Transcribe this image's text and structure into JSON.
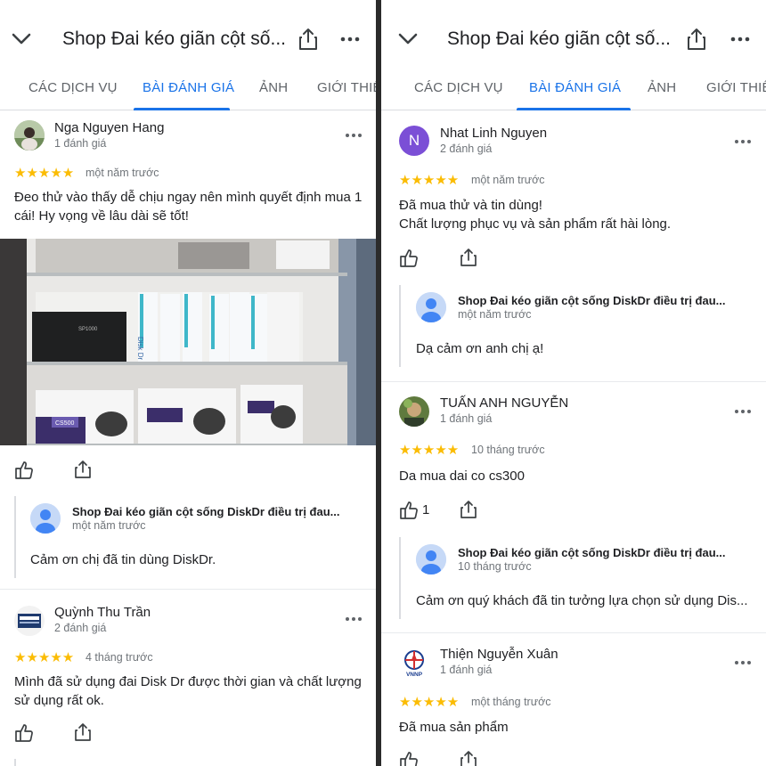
{
  "left": {
    "title": "Shop Đai kéo giãn cột số...",
    "tabs": [
      "CÁC DỊCH VỤ",
      "BÀI ĐÁNH GIÁ",
      "ẢNH",
      "GIỚI THIỆ"
    ],
    "reviews": [
      {
        "name": "Nga Nguyen Hang",
        "count": "1 đánh giá",
        "stars": "★★★★★",
        "date": "một năm trước",
        "text_lines": [
          "Đeo thử vào thấy dễ chịu ngay nên mình quyết định mua 1",
          "cái! Hy vọng về lâu dài sẽ tốt!"
        ],
        "reply": {
          "owner": "Shop Đai kéo giãn cột sống DiskDr điều trị đau...",
          "date": "một năm trước",
          "text": "Cảm ơn chị đã tin dùng DiskDr."
        }
      },
      {
        "name": "Quỳnh Thu Trần",
        "count": "2 đánh giá",
        "stars": "★★★★★",
        "date": "4 tháng trước",
        "text_lines": [
          "Mình đã sử dụng đai Disk Dr được thời gian và chất lượng",
          "sử dụng rất ok."
        ]
      }
    ],
    "photo_labels": {
      "box_brand": "Disk Dr",
      "model": "CS500",
      "device": "SP1000"
    }
  },
  "right": {
    "title": "Shop Đai kéo giãn cột số...",
    "tabs": [
      "CÁC DỊCH VỤ",
      "BÀI ĐÁNH GIÁ",
      "ẢNH",
      "GIỚI THIỆ"
    ],
    "reviews": [
      {
        "initial": "N",
        "name": "Nhat Linh Nguyen",
        "count": "2 đánh giá",
        "stars": "★★★★★",
        "date": "một năm trước",
        "text_lines": [
          "Đã mua thử và tin dùng!",
          "Chất lượng phục vụ và sản phẩm rất hài lòng."
        ],
        "reply": {
          "owner": "Shop Đai kéo giãn cột sống DiskDr điều trị đau...",
          "date": "một năm trước",
          "text": "Dạ cảm ơn anh chị ạ!"
        }
      },
      {
        "name": "TUẤN ANH NGUYỄN",
        "count": "1 đánh giá",
        "stars": "★★★★★",
        "date": "10 tháng trước",
        "text_lines": [
          "Da mua dai co cs300"
        ],
        "likes": "1",
        "reply": {
          "owner": "Shop Đai kéo giãn cột sống DiskDr điều trị đau...",
          "date": "10 tháng trước",
          "text": "Cảm ơn quý khách đã tin tưởng lựa chọn sử dụng Dis..."
        }
      },
      {
        "name": "Thiện Nguyễn Xuân",
        "count": "1 đánh giá",
        "stars": "★★★★★",
        "date": "một tháng trước",
        "text_lines": [
          "Đã mua sản phẩm"
        ],
        "avatar_logo": "VNNP"
      }
    ]
  },
  "colors": {
    "accent": "#1a73e8",
    "star": "#fbbc04",
    "secondary_text": "#70757a",
    "avatar_purple": "#7b4fd6"
  }
}
